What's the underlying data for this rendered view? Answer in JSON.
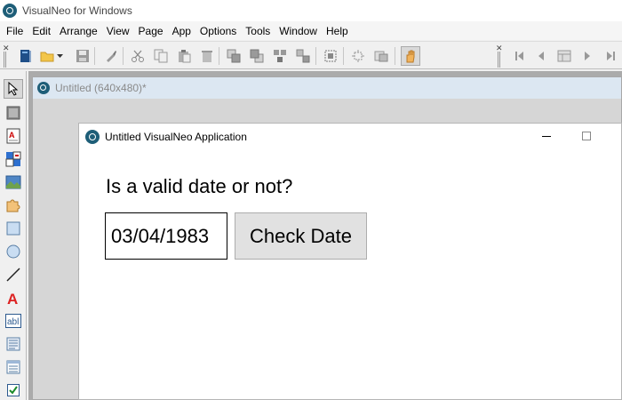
{
  "window": {
    "title": "VisualNeo for Windows"
  },
  "menubar": {
    "items": [
      "File",
      "Edit",
      "Arrange",
      "View",
      "Page",
      "App",
      "Options",
      "Tools",
      "Window",
      "Help"
    ]
  },
  "toolbar": {
    "left_icons": [
      "book-icon",
      "open-folder-icon",
      "dropdown-arrow-icon",
      "save-icon",
      "brush-icon",
      "cut-icon",
      "copy-icon",
      "paste-icon",
      "delete-icon",
      "bring-front-icon",
      "send-back-icon",
      "group-icon",
      "ungroup-icon",
      "select-all-icon",
      "align-icon",
      "size-icon",
      "hand-icon"
    ],
    "right_icons": [
      "first-page-icon",
      "prev-page-icon",
      "page-list-icon",
      "next-page-icon",
      "last-page-icon"
    ]
  },
  "toolbox": {
    "tools": [
      "pointer-tool-icon",
      "rectangle-tool-icon",
      "text-tool-icon",
      "button-tool-icon",
      "image-tool-icon",
      "plugin-tool-icon",
      "square-tool-icon",
      "circle-tool-icon",
      "line-tool-icon",
      "text-object-icon",
      "textbox-tool-icon",
      "container-tool-icon",
      "list-tool-icon",
      "checkbox-tool-icon"
    ]
  },
  "document": {
    "title": "Untitled (640x480)*"
  },
  "app_window": {
    "title": "Untitled VisualNeo Application",
    "question": "Is a valid date or not?",
    "date_value": "03/04/1983",
    "check_button": "Check Date"
  }
}
